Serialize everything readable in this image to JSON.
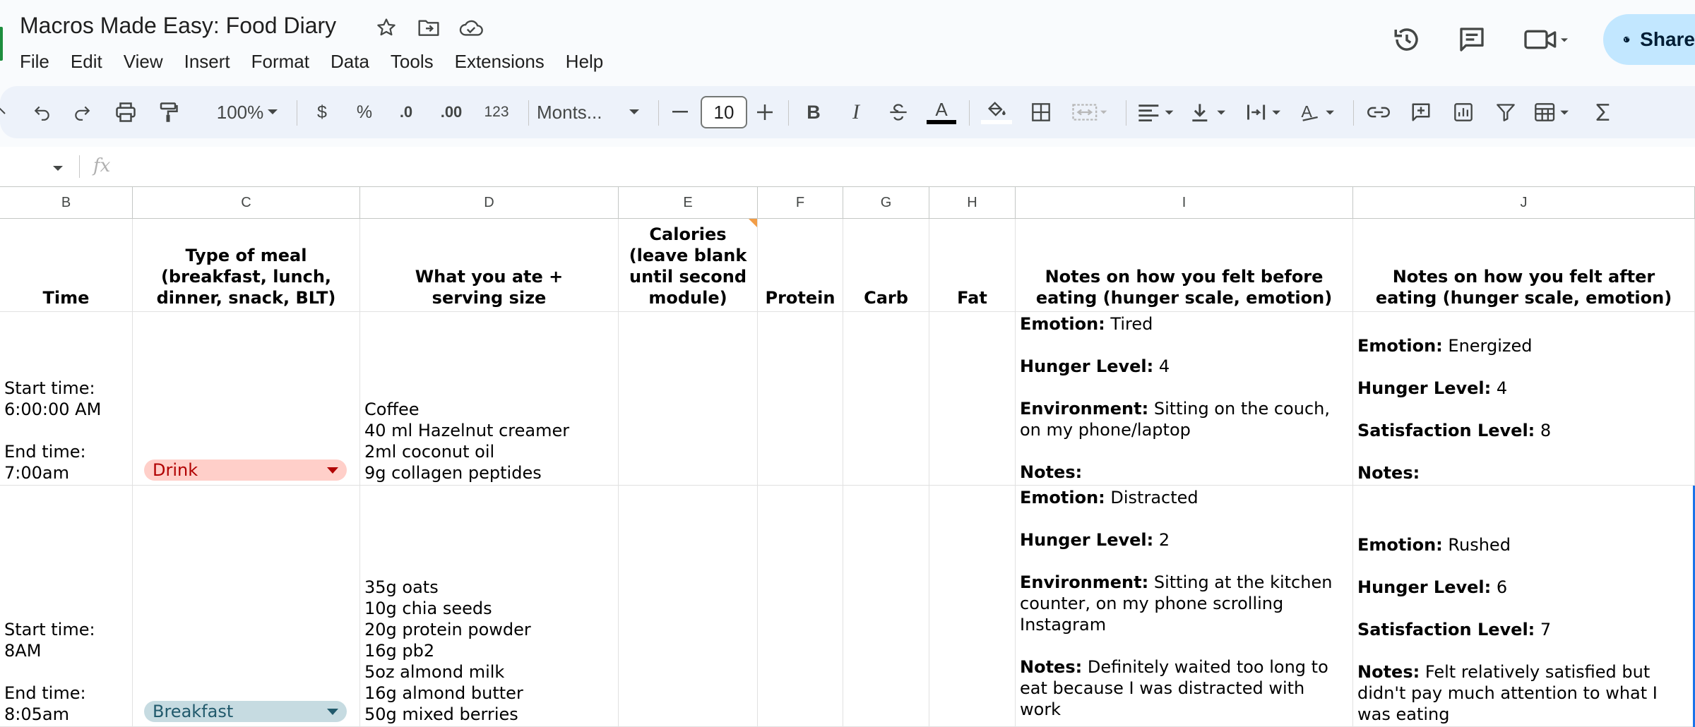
{
  "title": "Macros Made Easy: Food Diary",
  "menu": [
    "File",
    "Edit",
    "View",
    "Insert",
    "Format",
    "Data",
    "Tools",
    "Extensions",
    "Help"
  ],
  "share_label": "Share",
  "toolbar": {
    "zoom": "100%",
    "currency": "$",
    "percent": "%",
    "dec_decrease": ".0",
    "dec_increase": ".00",
    "number_format": "123",
    "font": "Monts...",
    "font_size": "10",
    "bold": "B",
    "italic": "I",
    "text_color": "A"
  },
  "formula": {
    "fx": "fx",
    "value": ""
  },
  "columns": [
    "B",
    "C",
    "D",
    "E",
    "F",
    "G",
    "H",
    "I",
    "J"
  ],
  "headers": {
    "time": "Time",
    "type": "Type of meal (breakfast, lunch, dinner, snack, BLT)",
    "what": "What you ate + serving size",
    "calories": "Calories (leave blank until second module)",
    "protein": "Protein",
    "carb": "Carb",
    "fat": "Fat",
    "before": "Notes on how you felt before eating (hunger scale, emotion)",
    "after": "Notes on how you felt after eating (hunger scale, emotion)"
  },
  "rows": [
    {
      "time_line1": "Start time:",
      "time_line2": "6:00:00 AM",
      "time_line3": "End time:",
      "time_line4": "7:00am",
      "type": "Drink",
      "what": "Coffee\n40 ml Hazelnut creamer\n2ml coconut oil\n9g collagen peptides",
      "before_emotion_label": "Emotion:",
      "before_emotion": "Tired",
      "before_hunger_label": "Hunger Level:",
      "before_hunger": "4",
      "before_env_label": "Environment:",
      "before_env": "Sitting on the couch, on my phone/laptop",
      "before_notes_label": "Notes:",
      "before_notes": "",
      "after_emotion_label": "Emotion:",
      "after_emotion": "Energized",
      "after_hunger_label": "Hunger Level:",
      "after_hunger": "4",
      "after_sat_label": "Satisfaction Level:",
      "after_sat": "8",
      "after_notes_label": "Notes:",
      "after_notes": ""
    },
    {
      "time_line1": "Start time:",
      "time_line2": "8AM",
      "time_line3": "End time:",
      "time_line4": "8:05am",
      "type": "Breakfast",
      "what": "35g oats\n10g chia seeds\n20g protein powder\n16g pb2\n5oz almond milk\n16g almond butter\n50g mixed berries",
      "before_emotion_label": "Emotion:",
      "before_emotion": "Distracted",
      "before_hunger_label": "Hunger Level:",
      "before_hunger": "2",
      "before_env_label": "Environment:",
      "before_env": "Sitting at the kitchen counter, on my phone scrolling Instagram",
      "before_notes_label": "Notes:",
      "before_notes": "Definitely waited too long to eat because I was distracted with work",
      "after_emotion_label": "Emotion:",
      "after_emotion": "Rushed",
      "after_hunger_label": "Hunger Level:",
      "after_hunger": "6",
      "after_sat_label": "Satisfaction Level:",
      "after_sat": "7",
      "after_notes_label": "Notes:",
      "after_notes": "Felt relatively satisfied but didn't pay much attention to what I was eating"
    }
  ],
  "colors": {
    "drink_chip_bg": "#ffcfc9",
    "drink_chip_text": "#b10202",
    "breakfast_chip_bg": "#c6dbe1",
    "breakfast_chip_text": "#215a6c",
    "share_bg": "#c2e7ff",
    "toolbar_bg": "#edf2fa"
  }
}
